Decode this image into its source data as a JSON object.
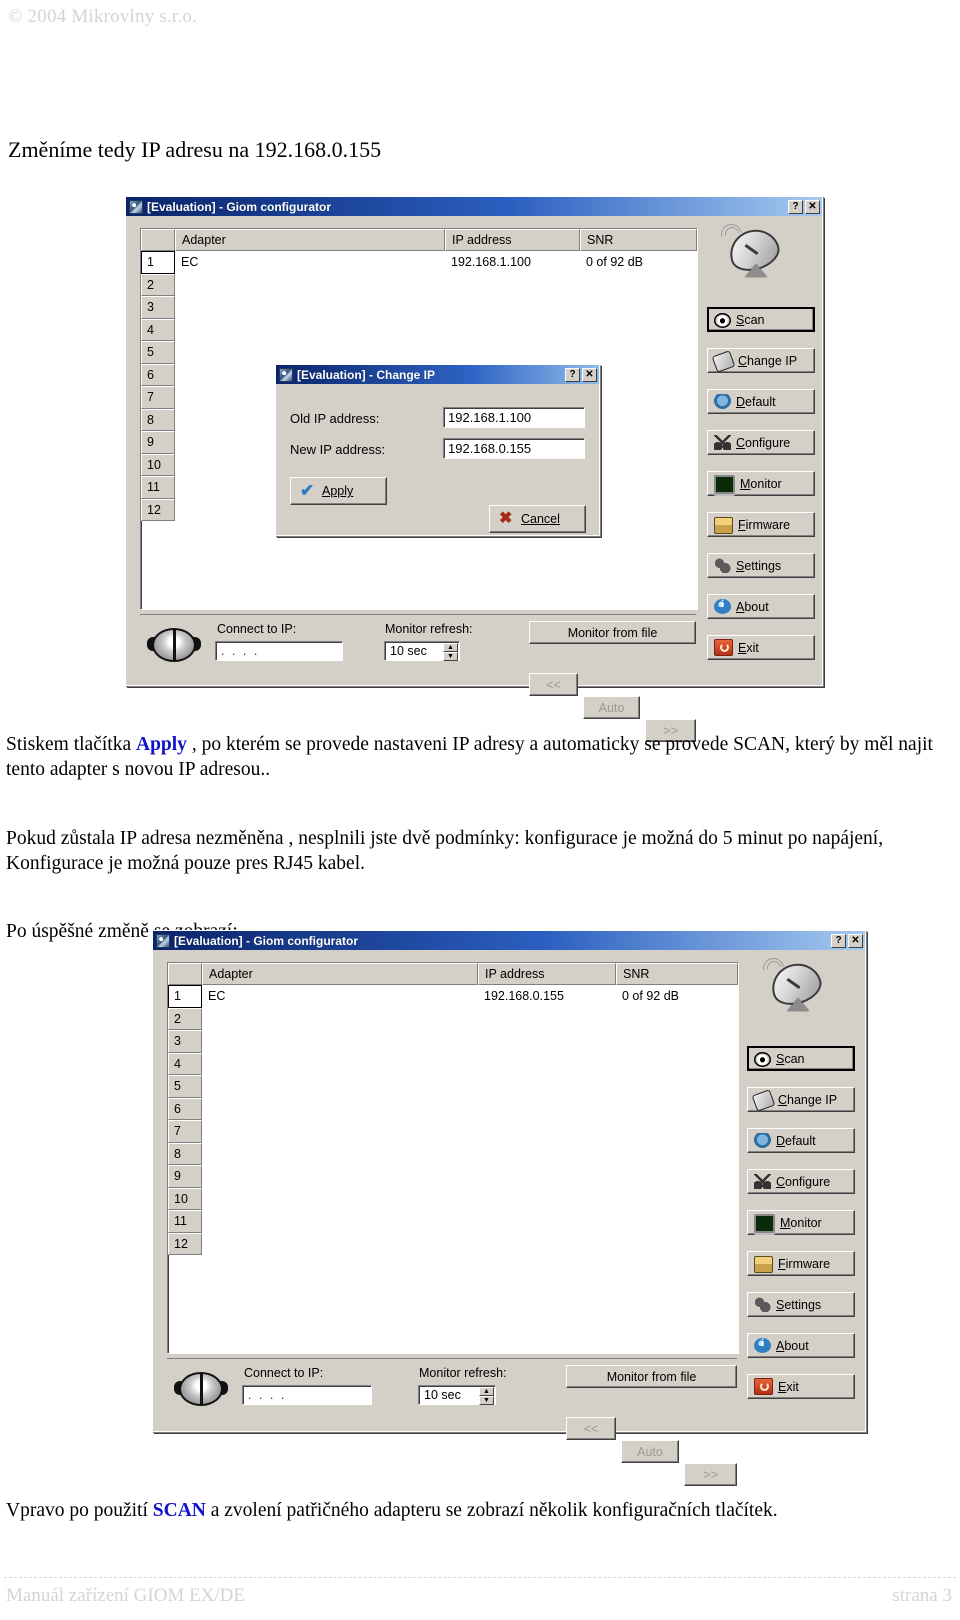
{
  "document": {
    "copyright": "© 2004 Mikrovlny s.r.o.",
    "heading": "Změníme tedy IP adresu na 192.168.0.155",
    "para1_before": "Stiskem tlačítka ",
    "para1_link": "Apply",
    "para1_after": " , po kterém se provede nastaveni IP adresy a automaticky se provede SCAN, který by měl najit tento adapter s novou IP adresou..",
    "para2": "Pokud zůstala IP adresa nezměněna , nesplnili jste dvě podmínky: konfigurace je možná do 5 minut po napájení, Konfigurace je možná pouze pres RJ45 kabel.",
    "para3": "Po úspěšné změně se zobrazí:",
    "para4_before": "Vpravo po použití ",
    "para4_link": "SCAN",
    "para4_after": " a zvolení patřičného adapteru se zobrazí několik konfiguračních tlačítek.",
    "footer_left": "Manuál zařízení GIOM EX/DE",
    "footer_right": "strana 3",
    "link_color": "#1111cc"
  },
  "window1": {
    "title": "[Evaluation] - Giom configurator",
    "title_icon": "app-icon",
    "help_button": "?",
    "close_button": "✕",
    "columns": [
      "",
      "Adapter",
      "IP address",
      "SNR"
    ],
    "rows": [
      {
        "num": "1",
        "adapter": "EC",
        "ip": "192.168.1.100",
        "snr": "0 of 92 dB",
        "selected": true
      },
      {
        "num": "2",
        "adapter": "",
        "ip": "",
        "snr": "",
        "selected": false
      },
      {
        "num": "3",
        "adapter": "",
        "ip": "",
        "snr": "",
        "selected": false
      },
      {
        "num": "4",
        "adapter": "",
        "ip": "",
        "snr": "",
        "selected": false
      },
      {
        "num": "5",
        "adapter": "",
        "ip": "",
        "snr": "",
        "selected": false
      },
      {
        "num": "6",
        "adapter": "",
        "ip": "",
        "snr": "",
        "selected": false
      },
      {
        "num": "7",
        "adapter": "",
        "ip": "",
        "snr": "",
        "selected": false
      },
      {
        "num": "8",
        "adapter": "",
        "ip": "",
        "snr": "",
        "selected": false
      },
      {
        "num": "9",
        "adapter": "",
        "ip": "",
        "snr": "",
        "selected": false
      },
      {
        "num": "10",
        "adapter": "",
        "ip": "",
        "snr": "",
        "selected": false
      },
      {
        "num": "11",
        "adapter": "",
        "ip": "",
        "snr": "",
        "selected": false
      },
      {
        "num": "12",
        "adapter": "",
        "ip": "",
        "snr": "",
        "selected": false
      }
    ],
    "buttons": [
      {
        "label": "Scan",
        "icon": "eye-icon",
        "default": true
      },
      {
        "label": "Change IP",
        "icon": "wrench-icon",
        "default": false
      },
      {
        "label": "Default",
        "icon": "bug-icon",
        "default": false
      },
      {
        "label": "Configure",
        "icon": "scissors-icon",
        "default": false
      },
      {
        "label": "Monitor",
        "icon": "monitor-icon",
        "default": false
      },
      {
        "label": "Firmware",
        "icon": "chip-icon",
        "default": false
      },
      {
        "label": "Settings",
        "icon": "gears-icon",
        "default": false
      },
      {
        "label": "About",
        "icon": "info-icon",
        "default": false
      },
      {
        "label": "Exit",
        "icon": "power-icon",
        "default": false
      }
    ],
    "bottom": {
      "connect_label": "Connect to IP:",
      "connect_value": ". . . .",
      "refresh_label": "Monitor refresh:",
      "refresh_value": "10 sec",
      "monitor_from_file": "Monitor from file",
      "nav_prev": "<<",
      "nav_auto": "Auto",
      "nav_next": ">>",
      "conn_icon": "network-connector-icon"
    }
  },
  "dialog": {
    "title": "[Evaluation] - Change IP",
    "title_icon": "change-ip-icon",
    "help_button": "?",
    "close_button": "✕",
    "old_ip_label": "Old IP address:",
    "old_ip_value": "192.168.1.100",
    "new_ip_label": "New IP address:",
    "new_ip_value": "192.168.0.155",
    "apply_label": "Apply",
    "apply_icon": "check-icon",
    "cancel_label": "Cancel",
    "cancel_icon": "x-icon"
  },
  "window2": {
    "title": "[Evaluation] - Giom configurator",
    "title_icon": "app-icon",
    "help_button": "?",
    "close_button": "✕",
    "columns": [
      "",
      "Adapter",
      "IP address",
      "SNR"
    ],
    "rows": [
      {
        "num": "1",
        "adapter": "EC",
        "ip": "192.168.0.155",
        "snr": "0 of 92 dB",
        "selected": true
      },
      {
        "num": "2",
        "adapter": "",
        "ip": "",
        "snr": "",
        "selected": false
      },
      {
        "num": "3",
        "adapter": "",
        "ip": "",
        "snr": "",
        "selected": false
      },
      {
        "num": "4",
        "adapter": "",
        "ip": "",
        "snr": "",
        "selected": false
      },
      {
        "num": "5",
        "adapter": "",
        "ip": "",
        "snr": "",
        "selected": false
      },
      {
        "num": "6",
        "adapter": "",
        "ip": "",
        "snr": "",
        "selected": false
      },
      {
        "num": "7",
        "adapter": "",
        "ip": "",
        "snr": "",
        "selected": false
      },
      {
        "num": "8",
        "adapter": "",
        "ip": "",
        "snr": "",
        "selected": false
      },
      {
        "num": "9",
        "adapter": "",
        "ip": "",
        "snr": "",
        "selected": false
      },
      {
        "num": "10",
        "adapter": "",
        "ip": "",
        "snr": "",
        "selected": false
      },
      {
        "num": "11",
        "adapter": "",
        "ip": "",
        "snr": "",
        "selected": false
      },
      {
        "num": "12",
        "adapter": "",
        "ip": "",
        "snr": "",
        "selected": false
      }
    ],
    "buttons": [
      {
        "label": "Scan",
        "icon": "eye-icon",
        "default": true
      },
      {
        "label": "Change IP",
        "icon": "wrench-icon",
        "default": false
      },
      {
        "label": "Default",
        "icon": "bug-icon",
        "default": false
      },
      {
        "label": "Configure",
        "icon": "scissors-icon",
        "default": false
      },
      {
        "label": "Monitor",
        "icon": "monitor-icon",
        "default": false
      },
      {
        "label": "Firmware",
        "icon": "chip-icon",
        "default": false
      },
      {
        "label": "Settings",
        "icon": "gears-icon",
        "default": false
      },
      {
        "label": "About",
        "icon": "info-icon",
        "default": false
      },
      {
        "label": "Exit",
        "icon": "power-icon",
        "default": false
      }
    ],
    "bottom": {
      "connect_label": "Connect to IP:",
      "connect_value": ". . . .",
      "refresh_label": "Monitor refresh:",
      "refresh_value": "10 sec",
      "monitor_from_file": "Monitor from file",
      "nav_prev": "<<",
      "nav_auto": "Auto",
      "nav_next": ">>",
      "conn_icon": "network-connector-icon"
    }
  }
}
